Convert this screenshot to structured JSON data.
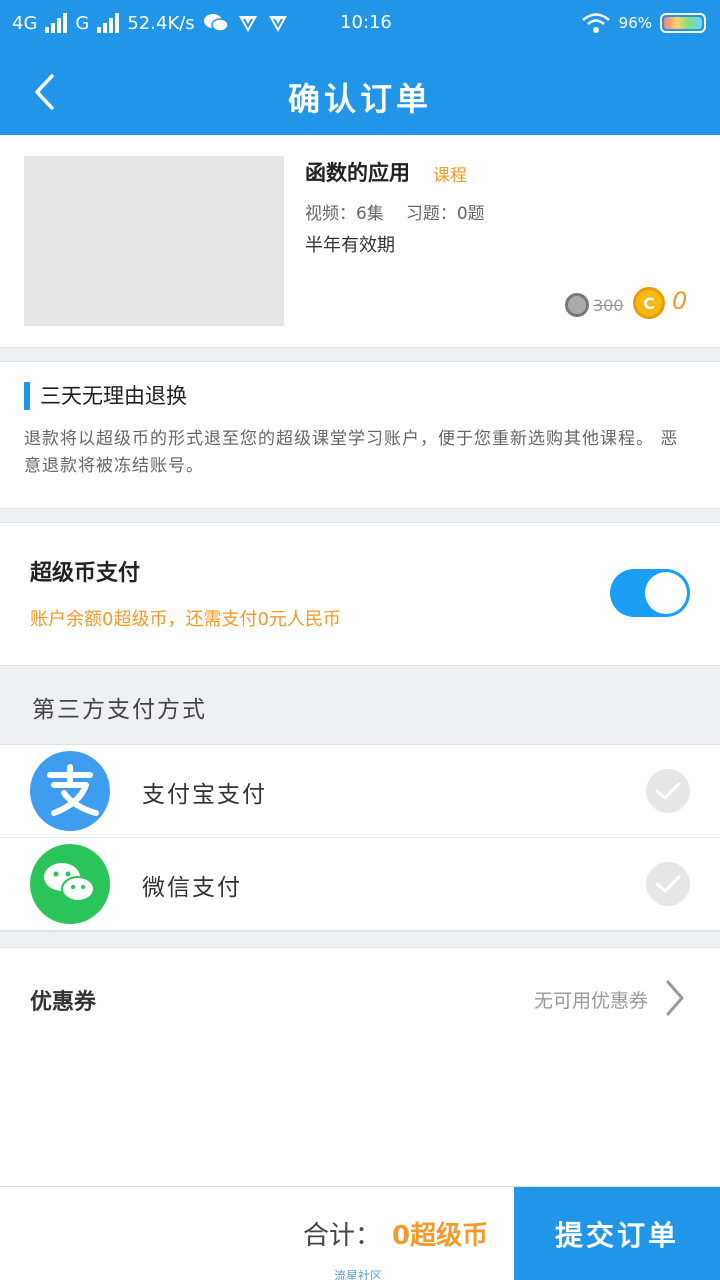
{
  "status_bar": {
    "net1": "4G",
    "net2": "G",
    "speed": "52.4K/s",
    "time": "10:16",
    "battery": "96%"
  },
  "header": {
    "title": "确认订单",
    "back_icon": "chevron-left-icon"
  },
  "course": {
    "name": "函数的应用",
    "tag": "课程",
    "video": "视频：6集",
    "exercise": "习题：0题",
    "validity": "半年有效期",
    "original_price": "300",
    "price": "0"
  },
  "refund": {
    "title": "三天无理由退换",
    "description": "退款将以超级币的形式退至您的超级课堂学习账户，便于您重新选购其他课程。 恶意退款将被冻结账号。"
  },
  "coin_payment": {
    "title": "超级币支付",
    "subtitle": "账户余额0超级币，还需支付0元人民币",
    "enabled": true
  },
  "third_party": {
    "title": "第三方支付方式",
    "options": [
      {
        "label": "支付宝支付",
        "icon": "alipay-icon",
        "color": "#3f9df0"
      },
      {
        "label": "微信支付",
        "icon": "wechat-icon",
        "color": "#2bc45a"
      }
    ]
  },
  "coupon": {
    "label": "优惠券",
    "value": "无可用优惠券"
  },
  "footer": {
    "total_label": "合计：",
    "total_value": "0超级币",
    "submit": "提交订单",
    "watermark": "流星社区"
  },
  "colors": {
    "primary": "#2196e8",
    "accent": "#f39a2b"
  }
}
